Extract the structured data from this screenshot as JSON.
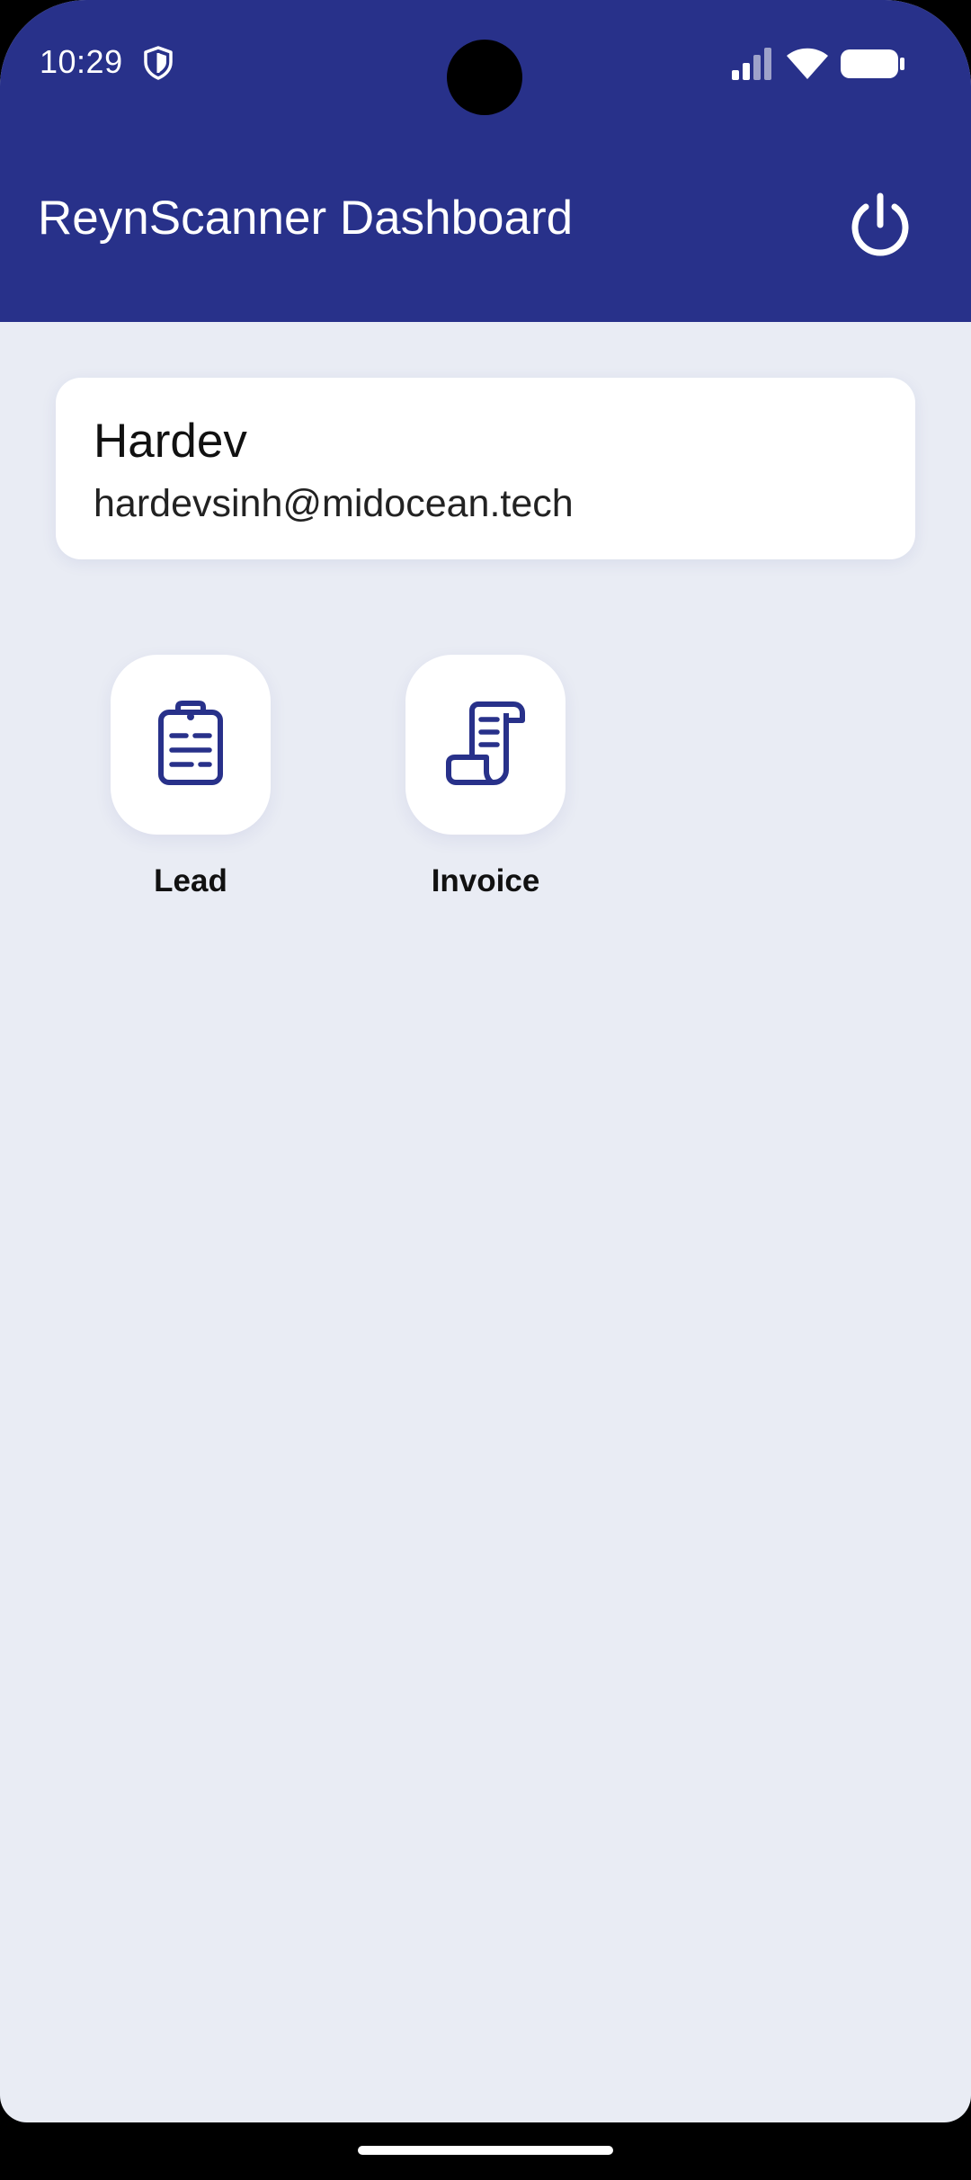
{
  "status_bar": {
    "time": "10:29",
    "icons": [
      "shield-icon",
      "signal-icon",
      "wifi-icon",
      "battery-icon"
    ]
  },
  "app_bar": {
    "title": "ReynScanner Dashboard",
    "action_icon": "power-icon",
    "background_color": "#28318a"
  },
  "user_card": {
    "name": "Hardev",
    "email": "hardevsinh@midocean.tech"
  },
  "menu": {
    "items": [
      {
        "label": "Lead",
        "icon": "clipboard-icon"
      },
      {
        "label": "Invoice",
        "icon": "receipt-scroll-icon"
      }
    ]
  },
  "colors": {
    "accent": "#28318a",
    "background": "#e9ecf4",
    "card": "#ffffff"
  }
}
